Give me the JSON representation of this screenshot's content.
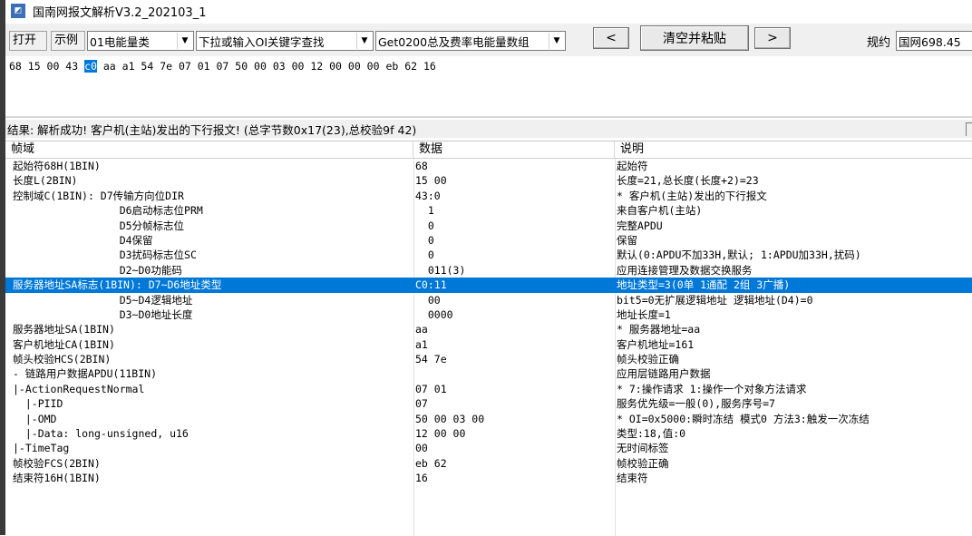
{
  "window": {
    "title": "国南网报文解析V3.2_202103_1",
    "icon": "app-icon"
  },
  "toolbar": {
    "open_label": "打开",
    "example_label": "示例",
    "example_select": "01电能量类",
    "search_combo": "下拉或输入OI关键字查找",
    "object_combo": "Get0200总及费率电能量数组",
    "prev_label": "<",
    "paste_label": "清空并粘贴",
    "next_label": ">",
    "protocol_label": "规约",
    "protocol_value": "国网698.45"
  },
  "hex": {
    "before": "68 15 00 43 ",
    "highlight": "c0",
    "after": " aa a1 54 7e 07 01 07 50 00 03 00 12 00 00 00 eb 62 16"
  },
  "result": {
    "text": "结果: 解析成功! 客户机(主站)发出的下行报文! (总字节数0x17(23),总校验9f 42)"
  },
  "table": {
    "headers": [
      "帧域",
      "数据",
      "说明"
    ],
    "rows": [
      {
        "field": "起始符68H(1BIN)",
        "data": "68",
        "desc": "起始符"
      },
      {
        "field": "长度L(2BIN)",
        "data": "15 00",
        "desc": "长度=21,总长度(长度+2)=23"
      },
      {
        "field": "控制域C(1BIN): D7传输方向位DIR",
        "data": "43:0",
        "desc": "* 客户机(主站)发出的下行报文"
      },
      {
        "field": "                 D6启动标志位PRM",
        "data": "  1",
        "desc": "来自客户机(主站)"
      },
      {
        "field": "                 D5分帧标志位",
        "data": "  0",
        "desc": "完整APDU"
      },
      {
        "field": "                 D4保留",
        "data": "  0",
        "desc": "保留"
      },
      {
        "field": "                 D3扰码标志位SC",
        "data": "  0",
        "desc": "默认(0:APDU不加33H,默认; 1:APDU加33H,扰码)"
      },
      {
        "field": "                 D2~D0功能码",
        "data": "  011(3)",
        "desc": "应用连接管理及数据交换服务"
      },
      {
        "field": "服务器地址SA标志(1BIN): D7~D6地址类型",
        "data": "C0:11",
        "desc": "地址类型=3(0单 1通配 2组 3广播)"
      },
      {
        "field": "                 D5~D4逻辑地址",
        "data": "  00",
        "desc": "bit5=0无扩展逻辑地址 逻辑地址(D4)=0"
      },
      {
        "field": "                 D3~D0地址长度",
        "data": "  0000",
        "desc": "地址长度=1"
      },
      {
        "field": "服务器地址SA(1BIN)",
        "data": "aa",
        "desc": "* 服务器地址=aa"
      },
      {
        "field": "客户机地址CA(1BIN)",
        "data": "a1",
        "desc": "客户机地址=161"
      },
      {
        "field": "帧头校验HCS(2BIN)",
        "data": "54 7e",
        "desc": "帧头校验正确"
      },
      {
        "field": "- 链路用户数据APDU(11BIN)",
        "data": "",
        "desc": "应用层链路用户数据"
      },
      {
        "field": "|-ActionRequestNormal",
        "data": "07 01",
        "desc": "* 7:操作请求 1:操作一个对象方法请求"
      },
      {
        "field": "  |-PIID",
        "data": "07",
        "desc": "服务优先级=一般(0),服务序号=7"
      },
      {
        "field": "  |-OMD",
        "data": "50 00 03 00",
        "desc": "* OI=0x5000:瞬时冻结 模式0 方法3:触发一次冻结"
      },
      {
        "field": "  |-Data: long-unsigned, u16",
        "data": "12 00 00",
        "desc": "类型:18,值:0"
      },
      {
        "field": "|-TimeTag",
        "data": "00",
        "desc": "无时间标签"
      },
      {
        "field": "帧校验FCS(2BIN)",
        "data": "eb 62",
        "desc": "帧校验正确"
      },
      {
        "field": "结束符16H(1BIN)",
        "data": "16",
        "desc": "结束符"
      }
    ],
    "selected_index": 8
  },
  "colors": {
    "selection": "#0078d7",
    "toolbar_bg": "#f0f0f0"
  }
}
